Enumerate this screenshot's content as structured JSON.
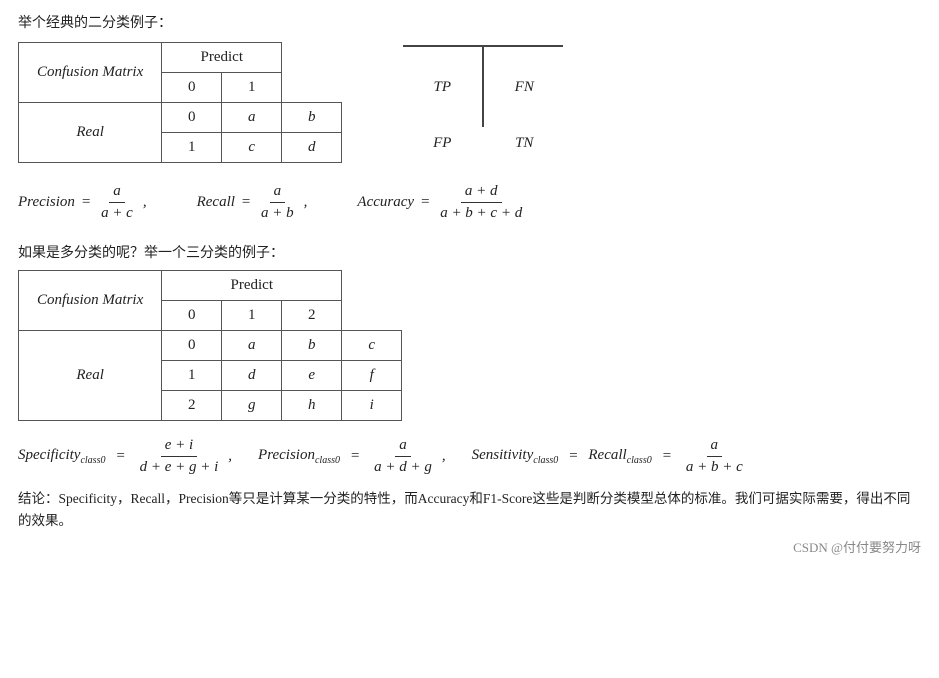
{
  "intro_binary": "举个经典的二分类例子：",
  "intro_multi": "如果是多分类的呢？举一个三分类的例子：",
  "binary_table": {
    "title": "Confusion Matrix",
    "predict_label": "Predict",
    "real_label": "Real",
    "col_headers": [
      "0",
      "1"
    ],
    "row_headers": [
      "0",
      "1"
    ],
    "cells": [
      [
        "a",
        "b"
      ],
      [
        "c",
        "d"
      ]
    ]
  },
  "tp_fn_grid": {
    "cells": [
      [
        "TP",
        "FN"
      ],
      [
        "FP",
        "TN"
      ]
    ]
  },
  "formulas": {
    "precision": {
      "label": "Precision",
      "num": "a",
      "den": "a + c"
    },
    "recall": {
      "label": "Recall",
      "num": "a",
      "den": "a + b"
    },
    "accuracy": {
      "label": "Accuracy",
      "num": "a + d",
      "den": "a + b + c + d"
    }
  },
  "multi_table": {
    "title": "Confusion Matrix",
    "predict_label": "Predict",
    "real_label": "Real",
    "col_headers": [
      "0",
      "1",
      "2"
    ],
    "row_headers": [
      "0",
      "1",
      "2"
    ],
    "cells": [
      [
        "a",
        "b",
        "c"
      ],
      [
        "d",
        "e",
        "f"
      ],
      [
        "g",
        "h",
        "i"
      ]
    ]
  },
  "multi_formulas": {
    "specificity": {
      "label": "Specificity",
      "subscript": "class0",
      "eq": "=",
      "num": "e + i",
      "den": "d + e + g + i"
    },
    "precision": {
      "label": "Precision",
      "subscript": "class0",
      "eq": "=",
      "num": "a",
      "den": "a + d + g"
    },
    "sensitivity": {
      "label": "Sensitivity",
      "subscript": "class0",
      "eq1": "=",
      "recall_label": "Recall",
      "recall_subscript": "class0",
      "eq2": "=",
      "num": "a",
      "den": "a + b + c"
    }
  },
  "conclusion": "结论：Specificity，Recall，Precision等只是计算某一分类的特性，而Accuracy和F1-Score这些是判断分类模型总体的标准。我们可据实际需要，得出不同的效果。",
  "footer": "CSDN @付付要努力呀"
}
